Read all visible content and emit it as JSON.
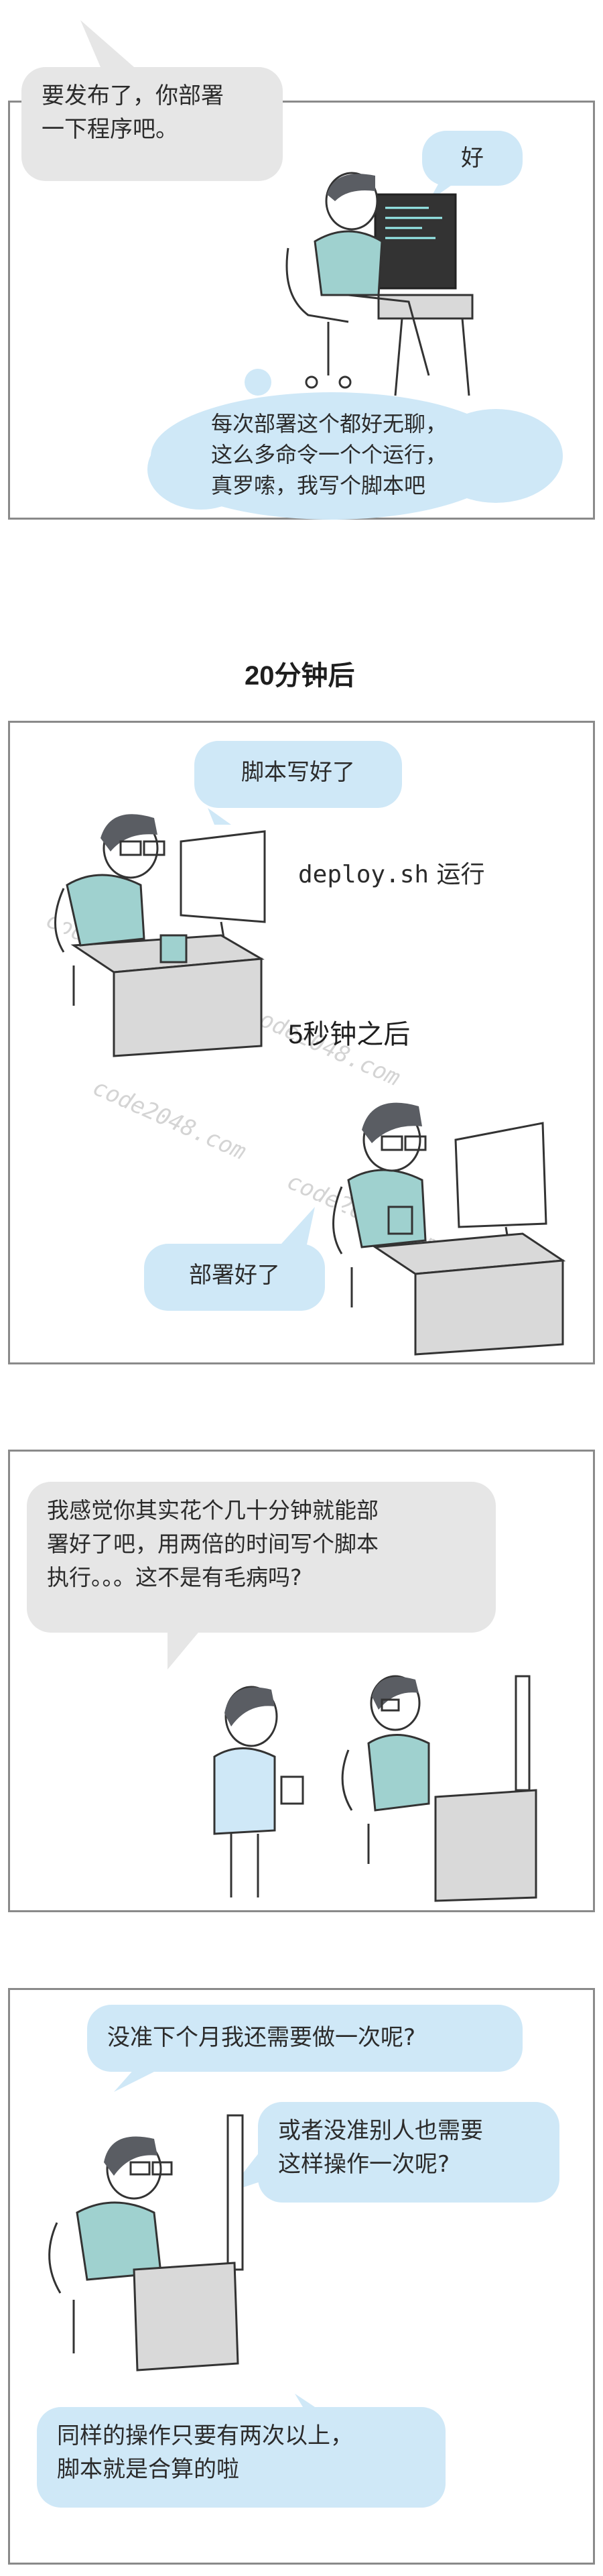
{
  "panel1": {
    "bubble_boss": "要发布了，你部署\n一下程序吧。",
    "bubble_ok": "好",
    "bubble_thought": "每次部署这个都好无聊，\n这么多命令一个个运行，\n真罗嗦，我写个脚本吧"
  },
  "caption1": "20分钟后",
  "panel2": {
    "bubble_done": "脚本写好了",
    "run_file": "deploy.sh",
    "run_verb": "运行",
    "caption_after": "5秒钟之后",
    "bubble_deployed": "部署好了",
    "watermark": "code2048.com"
  },
  "panel3": {
    "bubble_question": "我感觉你其实花个几十分钟就能部\n署好了吧，用两倍的时间写个脚本\n执行。。。这不是有毛病吗?"
  },
  "panel4": {
    "bubble_next_month": "没准下个月我还需要做一次呢?",
    "bubble_others": "或者没准别人也需要\n这样操作一次呢?",
    "bubble_conclusion": "同样的操作只要有两次以上，\n脚本就是合算的啦"
  },
  "colors": {
    "bubble_blue": "#cfe8f7",
    "bubble_grey": "#e6e6e6",
    "shirt": "#9fd1cf",
    "hair": "#5a5d63",
    "desk": "#d9d9d9"
  }
}
